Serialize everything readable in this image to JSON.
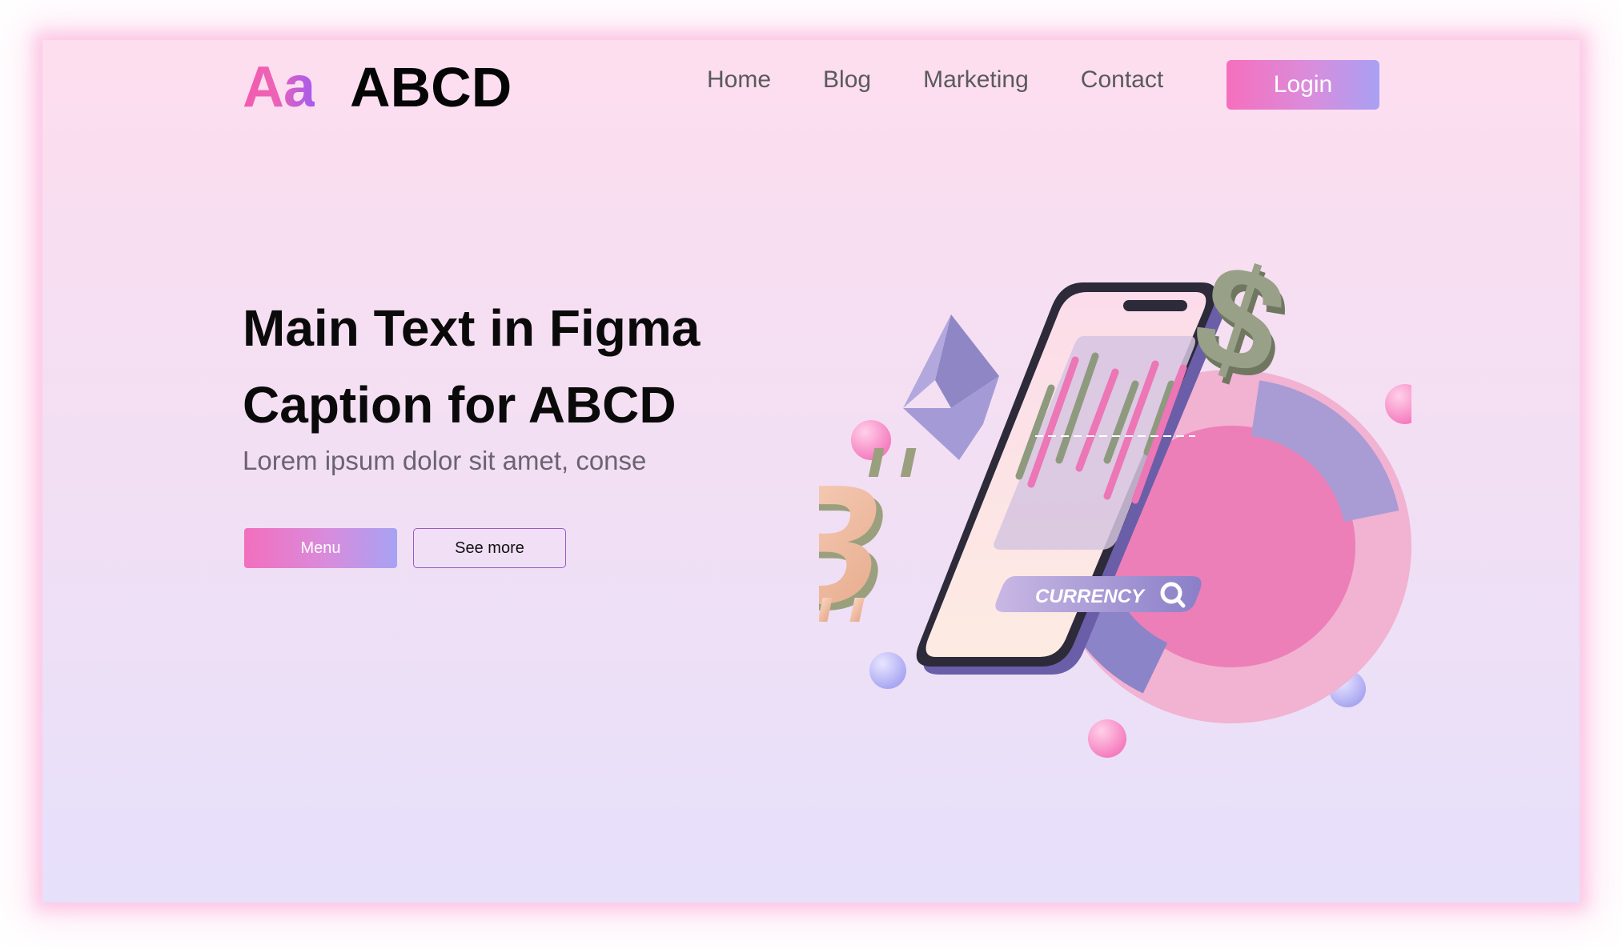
{
  "brand": {
    "mark": "Aa",
    "name": "ABCD"
  },
  "nav": {
    "items": [
      {
        "label": "Home"
      },
      {
        "label": "Blog"
      },
      {
        "label": "Marketing"
      },
      {
        "label": "Contact"
      }
    ],
    "login_label": "Login"
  },
  "hero": {
    "title_line1": "Main Text in Figma",
    "title_line2": "Caption for ABCD",
    "subtitle": "Lorem ipsum dolor sit amet, conse",
    "menu_button": "Menu",
    "see_more_button": "See more"
  },
  "illustration": {
    "search_label": "CURRENCY",
    "icons": [
      "bitcoin-icon",
      "dollar-icon",
      "ethereum-icon",
      "search-icon"
    ]
  },
  "colors": {
    "accent_pink": "#f56fbd",
    "accent_purple": "#a8a0f4",
    "background_top": "#fddeef",
    "background_bottom": "#e6e0fb"
  }
}
